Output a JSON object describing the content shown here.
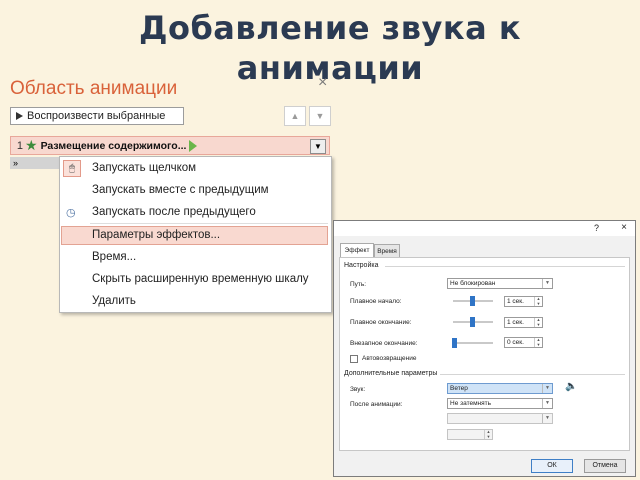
{
  "slide": {
    "title": "Добавление звука к анимации"
  },
  "anim_pane": {
    "title": "Область анимации",
    "close_glyph": "×",
    "play_button_label": "Воспроизвести выбранные",
    "item_number": "1",
    "item_name": "Размещение содержимого...",
    "expand_glyph": "»",
    "colors": {
      "accent": "#d9623a",
      "highlight": "#f8d8cf",
      "star": "#3c8c3c",
      "green": "#6ab64a"
    }
  },
  "context_menu": {
    "items": [
      "Запускать щелчком",
      "Запускать вместе с предыдущим",
      "Запускать после предыдущего",
      "Параметры эффектов...",
      "Время...",
      "Скрыть расширенную временную шкалу",
      "Удалить"
    ]
  },
  "dialog": {
    "help_glyph": "?",
    "close_glyph": "×",
    "tabs": [
      "Эффект",
      "Время"
    ],
    "section_settings": "Настройка",
    "path_label": "Путь:",
    "path_value": "Не блокирован",
    "smooth_start_label": "Плавное начало:",
    "smooth_start_value": "1 сек.",
    "smooth_end_label": "Плавное окончание:",
    "smooth_end_value": "1 сек.",
    "bounce_end_label": "Внезапное окончание:",
    "bounce_end_value": "0 сек.",
    "autoreverse_label": "Автовозвращение",
    "section_extra": "Дополнительные параметры",
    "sound_label": "Звук:",
    "sound_value": "Ветер",
    "after_anim_label": "После анимации:",
    "after_anim_value": "Не затемнять",
    "ok_label": "ОК",
    "cancel_label": "Отмена",
    "sliders": {
      "smooth_start": 0.5,
      "smooth_end": 0.5,
      "bounce_end": 0.0
    }
  }
}
